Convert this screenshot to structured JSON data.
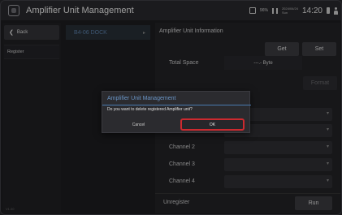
{
  "titlebar": {
    "title": "Amplifier Unit Management",
    "status": {
      "battery_percent": "96%",
      "date_line1": "2024/04/24",
      "date_line2": "Sun",
      "time": "14:20"
    }
  },
  "sidebar": {
    "back_label": "Back",
    "items": [
      {
        "label": "Register"
      }
    ],
    "version": "V1.00"
  },
  "device": {
    "name": "B4-06  DOCK"
  },
  "panel": {
    "title": "Amplifier Unit Information",
    "get_label": "Get",
    "set_label": "Set",
    "total_space_label": "Total Space",
    "total_space_value": "---.- Byte",
    "format_label": "Format",
    "channels": [
      {
        "label": "Channel 2",
        "value": ""
      },
      {
        "label": "Channel 3",
        "value": ""
      },
      {
        "label": "Channel 4",
        "value": ""
      }
    ],
    "unregister_label": "Unregister",
    "run_label": "Run"
  },
  "dialog": {
    "title": "Amplifier Unit Management",
    "message": "Do you want to delete registered Amplifier unit?",
    "cancel_label": "Cancel",
    "ok_label": "OK"
  },
  "colors": {
    "accent_blue": "#6a95c6",
    "highlight_red": "#cc2a2f",
    "background": "#1d1d20"
  },
  "icons": {
    "app": "app-window-icon",
    "back": "chevron-left-icon",
    "device_expand": "chevron-right-icon",
    "select_caret": "chevron-down-icon"
  }
}
